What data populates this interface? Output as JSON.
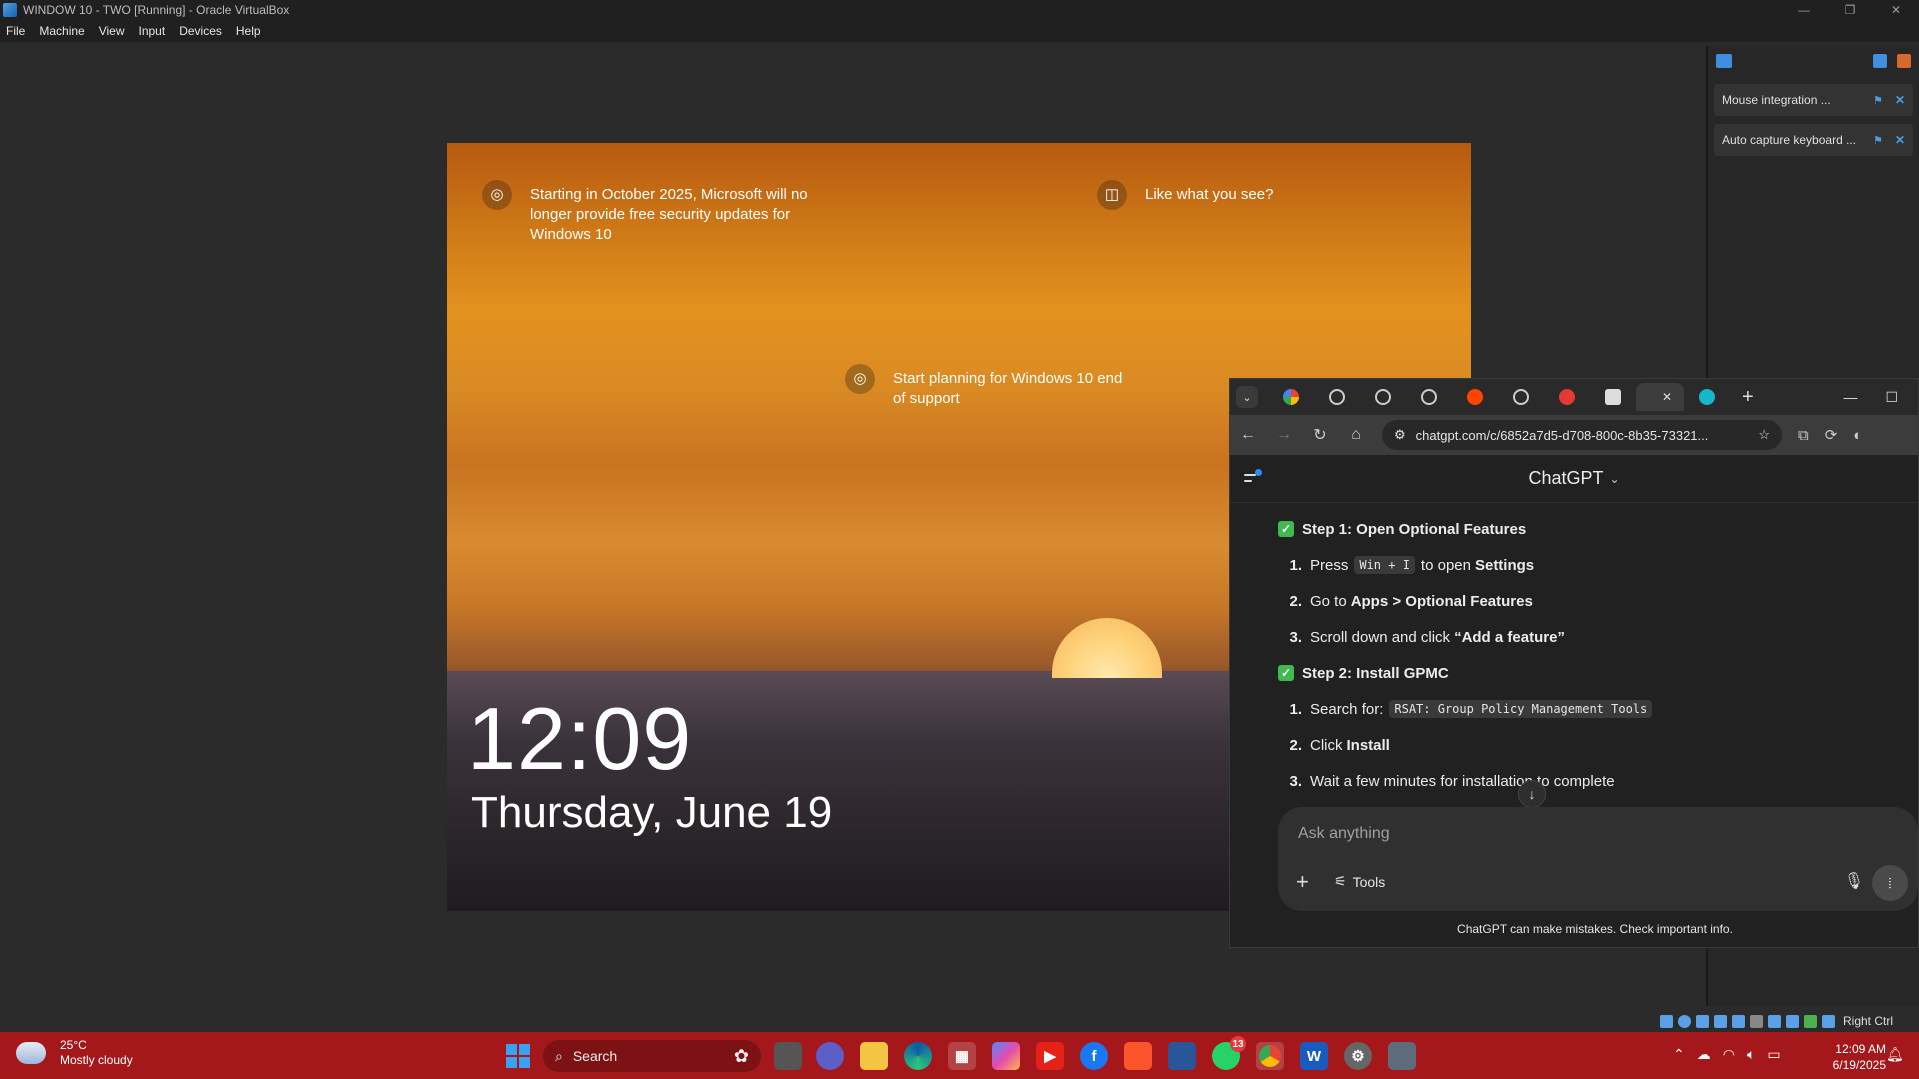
{
  "vbox": {
    "title": "WINDOW 10 - TWO [Running] - Oracle VirtualBox",
    "menu": [
      "File",
      "Machine",
      "View",
      "Input",
      "Devices",
      "Help"
    ],
    "notifications": [
      {
        "label": "Mouse integration ..."
      },
      {
        "label": "Auto capture keyboard ..."
      }
    ],
    "status_right_ctrl": "Right Ctrl"
  },
  "lockscreen": {
    "spotlight_1": "Starting in October 2025, Microsoft will no longer provide free security updates for Windows 10",
    "spotlight_2": "Like what you see?",
    "spotlight_3": "Start planning for Windows 10 end of support",
    "time": "12:09",
    "date": "Thursday, June 19"
  },
  "chrome": {
    "url": "chatgpt.com/c/6852a7d5-d708-800c-8b35-73321...",
    "tab_icons": [
      "google-icon",
      "chatgpt-icon",
      "chatgpt-icon",
      "chatgpt-icon",
      "reddit-icon",
      "chatgpt-icon",
      "red-app-icon",
      "k-icon",
      "chatgpt-icon-active",
      "m-icon"
    ],
    "colors": {
      "accent": "#2f8cf5",
      "check": "#3fb950"
    }
  },
  "chatgpt": {
    "model": "ChatGPT",
    "step1": {
      "heading": "Step 1: Open Optional Features",
      "items": [
        {
          "num": "1.",
          "pre": "Press",
          "code": "Win + I",
          "mid": "to open",
          "bold": "Settings"
        },
        {
          "num": "2.",
          "pre": "Go to",
          "bold": "Apps > Optional Features"
        },
        {
          "num": "3.",
          "pre": "Scroll down and click",
          "bold": "“Add a feature”"
        }
      ]
    },
    "step2": {
      "heading": "Step 2: Install GPMC",
      "items": [
        {
          "num": "1.",
          "pre": "Search for:",
          "code": "RSAT: Group Policy Management Tools"
        },
        {
          "num": "2.",
          "pre": "Click",
          "bold": "Install"
        },
        {
          "num": "3.",
          "pre": "Wait a few minutes for installation to complete"
        }
      ]
    },
    "composer_placeholder": "Ask anything",
    "tools_label": "Tools",
    "disclaimer": "ChatGPT can make mistakes. Check important info."
  },
  "taskbar": {
    "weather_temp": "25°C",
    "weather_desc": "Mostly cloudy",
    "search_label": "Search",
    "whatsapp_badge": "13",
    "time": "12:09 AM",
    "date": "6/19/2025",
    "color": "#a4181b"
  }
}
